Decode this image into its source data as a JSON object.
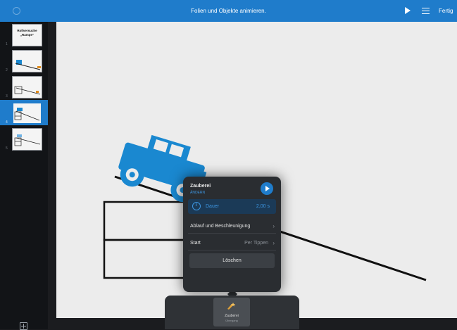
{
  "topbar": {
    "title": "Folien und Objekte animieren.",
    "done_label": "Fertig"
  },
  "sidebar": {
    "slides": [
      {
        "number": "1",
        "title_line1": "Rollversuche",
        "title_line2": "„Rampe“"
      },
      {
        "number": "2"
      },
      {
        "number": "3"
      },
      {
        "number": "4"
      },
      {
        "number": "5"
      }
    ]
  },
  "popover": {
    "effect_name": "Zauberei",
    "effect_type": "ÄNDERN",
    "duration_label": "Dauer",
    "duration_value": "2,00 s",
    "sequence_label": "Ablauf und Beschleunigung",
    "start_label": "Start",
    "start_value": "Per Tippen",
    "delete_label": "Löschen"
  },
  "transition_tray": {
    "tile_label": "Zauberei",
    "tile_sublabel": "Übergang"
  },
  "colors": {
    "accent": "#1f7ccb",
    "jeep": "#1a88d0",
    "popover_bg": "#2a2d31"
  },
  "icons": {
    "play": "play-icon",
    "list": "list-icon",
    "clock": "clock-icon",
    "chevron": "chevron-right-icon",
    "add_slide": "add-slide-icon",
    "transition": "magic-icon"
  }
}
